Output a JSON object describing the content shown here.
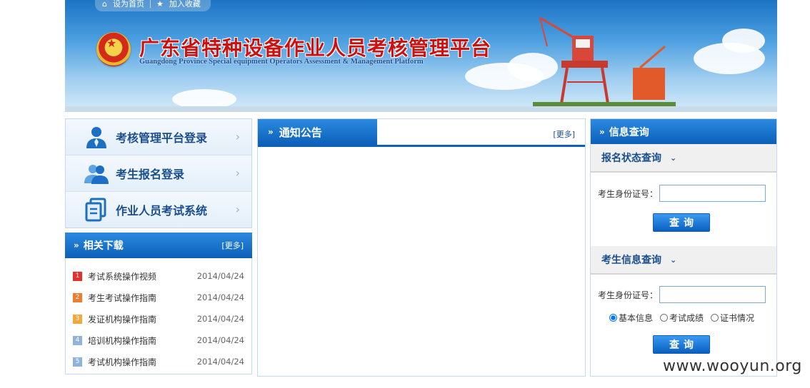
{
  "header": {
    "nav": [
      {
        "icon": "home-icon",
        "label": "设为首页"
      },
      {
        "icon": "star-icon",
        "label": "加入收藏"
      }
    ],
    "title": "广东省特种设备作业人员考核管理平台",
    "subtitle": "Guangdong Province Special equipment Operators Assessment & Management Platform"
  },
  "login": {
    "items": [
      {
        "icon": "user-icon",
        "label": "考核管理平台登录"
      },
      {
        "icon": "users-icon",
        "label": "考生报名登录"
      },
      {
        "icon": "document-icon",
        "label": "作业人员考试系统"
      }
    ]
  },
  "downloads": {
    "title": "相关下载",
    "more": "[更多]",
    "items": [
      {
        "num": "1",
        "color": "#e8302a",
        "label": "考试系统操作视频",
        "date": "2014/04/24"
      },
      {
        "num": "2",
        "color": "#ef7b2e",
        "label": "考生考试操作指南",
        "date": "2014/04/24"
      },
      {
        "num": "3",
        "color": "#f2a93b",
        "label": "发证机构操作指南",
        "date": "2014/04/24"
      },
      {
        "num": "4",
        "color": "#8fb3dc",
        "label": "培训机构操作指南",
        "date": "2014/04/24"
      },
      {
        "num": "5",
        "color": "#8fb3dc",
        "label": "考试机构操作指南",
        "date": "2014/04/24"
      }
    ]
  },
  "notice": {
    "title": "通知公告",
    "more": "[更多]"
  },
  "info": {
    "title": "信息查询",
    "status": {
      "title": "报名状态查询",
      "id_label": "考生身份证号：",
      "id_value": "",
      "button": "查询"
    },
    "exam": {
      "title": "考生信息查询",
      "id_label": "考生身份证号：",
      "id_value": "",
      "options": [
        "基本信息",
        "考试成绩",
        "证书情况"
      ],
      "selected": "基本信息",
      "button": "查询"
    }
  },
  "watermark": "www.wooyun.org",
  "colors": {
    "primary_blue": "#0d5fb8",
    "title_red": "#cc1111"
  }
}
